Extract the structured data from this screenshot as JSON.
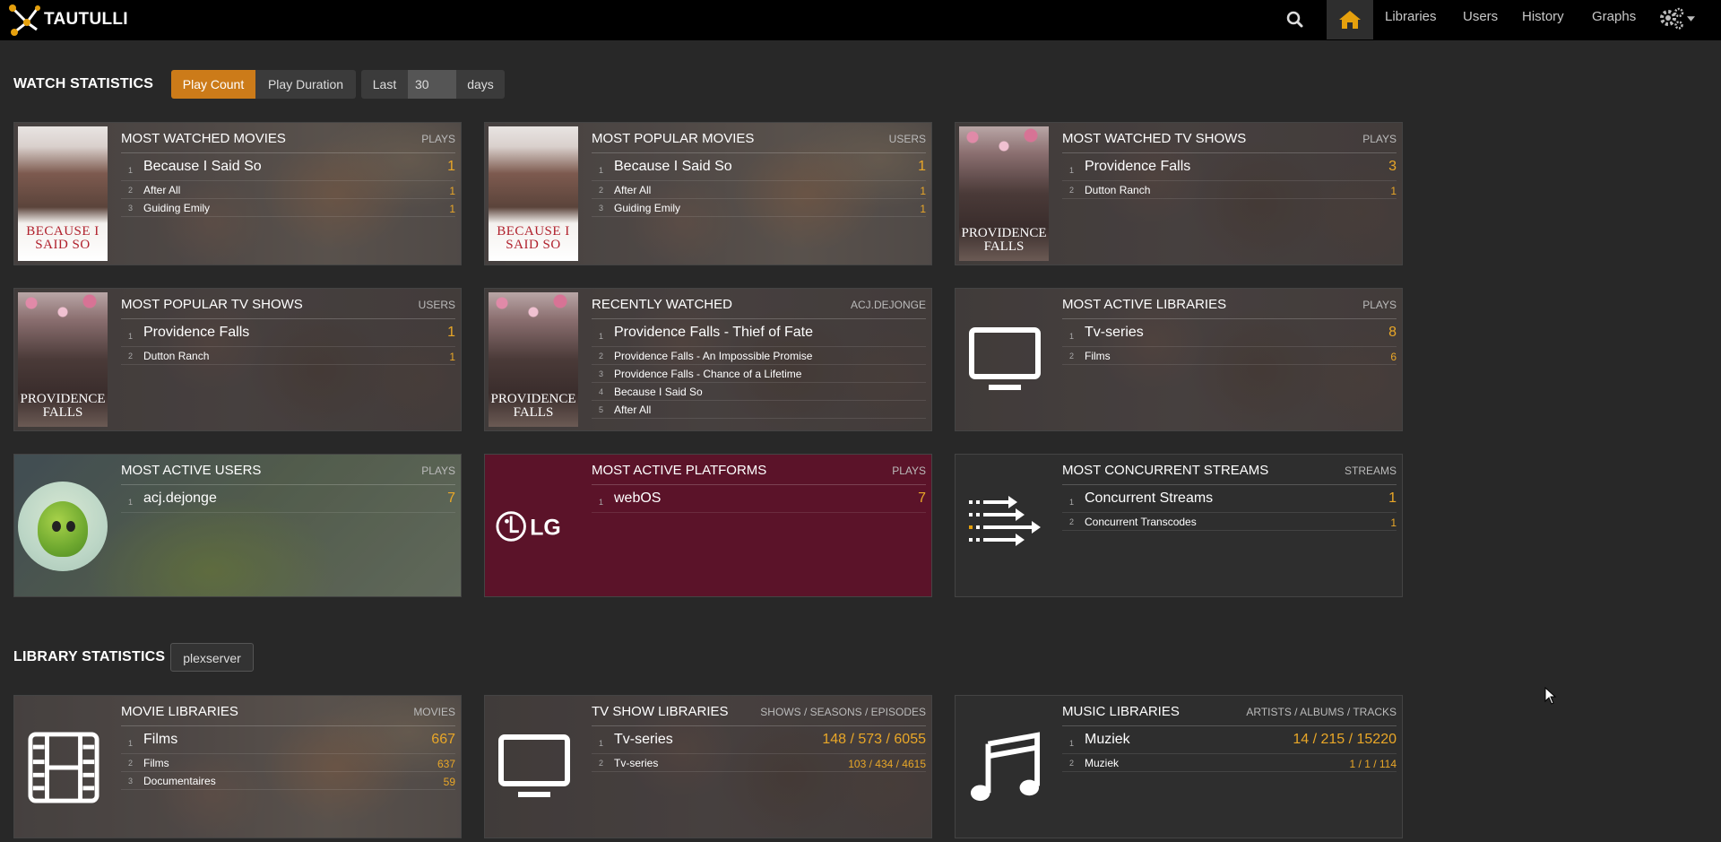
{
  "app": {
    "name": "TAUTULLI"
  },
  "nav": {
    "links": [
      "Libraries",
      "Users",
      "History",
      "Graphs"
    ]
  },
  "watch": {
    "title": "WATCH STATISTICS",
    "play_count": "Play Count",
    "play_duration": "Play Duration",
    "last_label": "Last",
    "days_value": "30",
    "days_label": "days"
  },
  "library": {
    "title": "LIBRARY STATISTICS",
    "server": "plexserver"
  },
  "cards": {
    "most_watched_movies": {
      "title": "MOST WATCHED MOVIES",
      "unit": "PLAYS",
      "rows": [
        {
          "n": "1",
          "name": "Because I Said So",
          "val": "1"
        },
        {
          "n": "2",
          "name": "After All",
          "val": "1"
        },
        {
          "n": "3",
          "name": "Guiding Emily",
          "val": "1"
        }
      ]
    },
    "most_popular_movies": {
      "title": "MOST POPULAR MOVIES",
      "unit": "USERS",
      "rows": [
        {
          "n": "1",
          "name": "Because I Said So",
          "val": "1"
        },
        {
          "n": "2",
          "name": "After All",
          "val": "1"
        },
        {
          "n": "3",
          "name": "Guiding Emily",
          "val": "1"
        }
      ]
    },
    "most_watched_tv": {
      "title": "MOST WATCHED TV SHOWS",
      "unit": "PLAYS",
      "rows": [
        {
          "n": "1",
          "name": "Providence Falls",
          "val": "3"
        },
        {
          "n": "2",
          "name": "Dutton Ranch",
          "val": "1"
        }
      ]
    },
    "most_popular_tv": {
      "title": "MOST POPULAR TV SHOWS",
      "unit": "USERS",
      "rows": [
        {
          "n": "1",
          "name": "Providence Falls",
          "val": "1"
        },
        {
          "n": "2",
          "name": "Dutton Ranch",
          "val": "1"
        }
      ]
    },
    "recently_watched": {
      "title": "RECENTLY WATCHED",
      "unit": "ACJ.DEJONGE",
      "rows": [
        {
          "n": "1",
          "name": "Providence Falls - Thief of Fate",
          "val": ""
        },
        {
          "n": "2",
          "name": "Providence Falls - An Impossible Promise",
          "val": ""
        },
        {
          "n": "3",
          "name": "Providence Falls - Chance of a Lifetime",
          "val": ""
        },
        {
          "n": "4",
          "name": "Because I Said So",
          "val": ""
        },
        {
          "n": "5",
          "name": "After All",
          "val": ""
        }
      ]
    },
    "most_active_libraries": {
      "title": "MOST ACTIVE LIBRARIES",
      "unit": "PLAYS",
      "rows": [
        {
          "n": "1",
          "name": "Tv-series",
          "val": "8"
        },
        {
          "n": "2",
          "name": "Films",
          "val": "6"
        }
      ]
    },
    "most_active_users": {
      "title": "MOST ACTIVE USERS",
      "unit": "PLAYS",
      "rows": [
        {
          "n": "1",
          "name": "acj.dejonge",
          "val": "7"
        }
      ]
    },
    "most_active_platforms": {
      "title": "MOST ACTIVE PLATFORMS",
      "unit": "PLAYS",
      "rows": [
        {
          "n": "1",
          "name": "webOS",
          "val": "7"
        }
      ]
    },
    "most_concurrent": {
      "title": "MOST CONCURRENT STREAMS",
      "unit": "STREAMS",
      "rows": [
        {
          "n": "1",
          "name": "Concurrent Streams",
          "val": "1"
        },
        {
          "n": "2",
          "name": "Concurrent Transcodes",
          "val": "1"
        }
      ]
    },
    "movie_libraries": {
      "title": "MOVIE LIBRARIES",
      "unit": "MOVIES",
      "rows": [
        {
          "n": "1",
          "name": "Films",
          "val": "667"
        },
        {
          "n": "2",
          "name": "Films",
          "val": "637"
        },
        {
          "n": "3",
          "name": "Documentaires",
          "val": "59"
        }
      ]
    },
    "tv_libraries": {
      "title": "TV SHOW LIBRARIES",
      "unit": "SHOWS / SEASONS / EPISODES",
      "rows": [
        {
          "n": "1",
          "name": "Tv-series",
          "val": "148 / 573 / 6055"
        },
        {
          "n": "2",
          "name": "Tv-series",
          "val": "103 / 434 / 4615"
        }
      ]
    },
    "music_libraries": {
      "title": "MUSIC LIBRARIES",
      "unit": "ARTISTS / ALBUMS / TRACKS",
      "rows": [
        {
          "n": "1",
          "name": "Muziek",
          "val": "14 / 215 / 15220"
        },
        {
          "n": "2",
          "name": "Muziek",
          "val": "1 / 1 / 114"
        }
      ]
    }
  },
  "posters": {
    "because_i_said_so": "BECAUSE I SAID SO",
    "providence_falls": "PROVIDENCE FALLS",
    "lg_logo": "LG"
  },
  "colors": {
    "accent": "#cc7b19",
    "value": "#e9a728",
    "navbar": "#000000",
    "background": "#282828"
  }
}
